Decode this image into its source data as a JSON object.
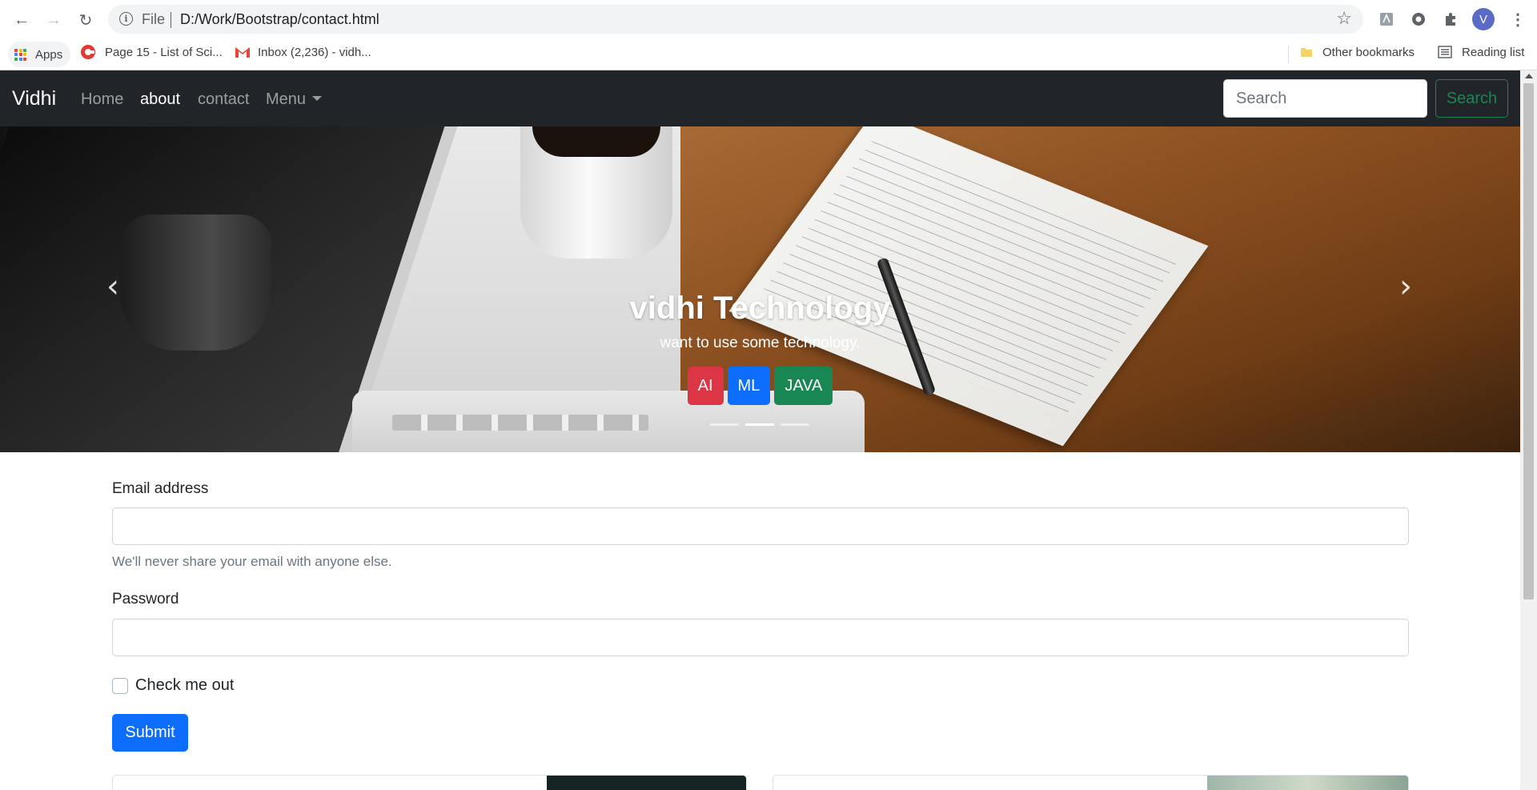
{
  "browser": {
    "back": "←",
    "forward": "→",
    "reload": "↻",
    "info_glyph": "i",
    "scheme_label": "File",
    "url": "D:/Work/Bootstrap/contact.html",
    "star": "☆",
    "profile_initial": "V",
    "menu_glyph": "⋮"
  },
  "bookmarks": {
    "apps": "Apps",
    "items": [
      {
        "label": "Page 15 - List of Sci..."
      },
      {
        "label": "Inbox (2,236) - vidh..."
      }
    ],
    "other": "Other bookmarks",
    "reading_list": "Reading list"
  },
  "navbar": {
    "brand": "Vidhi",
    "links": [
      "Home",
      "about",
      "contact"
    ],
    "menu": "Menu",
    "search_placeholder": "Search",
    "search_button": "Search"
  },
  "carousel": {
    "prev": "‹",
    "next": "›",
    "title": "vidhi Technology",
    "subtitle": "want to use some technology.",
    "buttons": [
      "AI",
      "ML",
      "JAVA"
    ],
    "active_slide": 2,
    "slide_count": 3
  },
  "form": {
    "email_label": "Email address",
    "email_help": "We'll never share your email with anyone else.",
    "password_label": "Password",
    "checkbox_label": "Check me out",
    "submit": "Submit"
  },
  "colors": {
    "navbar_bg": "#212529",
    "primary": "#0d6efd",
    "success": "#198754",
    "danger": "#dc3545"
  }
}
